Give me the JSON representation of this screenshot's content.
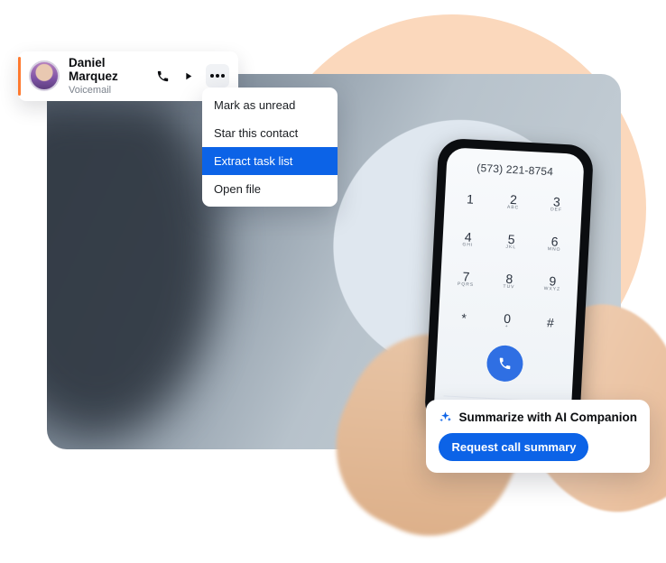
{
  "voicemail": {
    "name": "Daniel Marquez",
    "subtitle": "Voicemail"
  },
  "menu": {
    "items": [
      {
        "label": "Mark as unread"
      },
      {
        "label": "Star this contact"
      },
      {
        "label": "Extract task list",
        "selected": true
      },
      {
        "label": "Open file"
      }
    ]
  },
  "phone": {
    "number": "(573) 221-8754",
    "keys": [
      {
        "d": "1",
        "s": ""
      },
      {
        "d": "2",
        "s": "ABC"
      },
      {
        "d": "3",
        "s": "DEF"
      },
      {
        "d": "4",
        "s": "GHI"
      },
      {
        "d": "5",
        "s": "JKL"
      },
      {
        "d": "6",
        "s": "MNO"
      },
      {
        "d": "7",
        "s": "PQRS"
      },
      {
        "d": "8",
        "s": "TUV"
      },
      {
        "d": "9",
        "s": "WXYZ"
      },
      {
        "d": "*",
        "s": ""
      },
      {
        "d": "0",
        "s": "+"
      },
      {
        "d": "#",
        "s": ""
      }
    ]
  },
  "ai": {
    "title": "Summarize with AI Companion",
    "button": "Request call summary"
  }
}
